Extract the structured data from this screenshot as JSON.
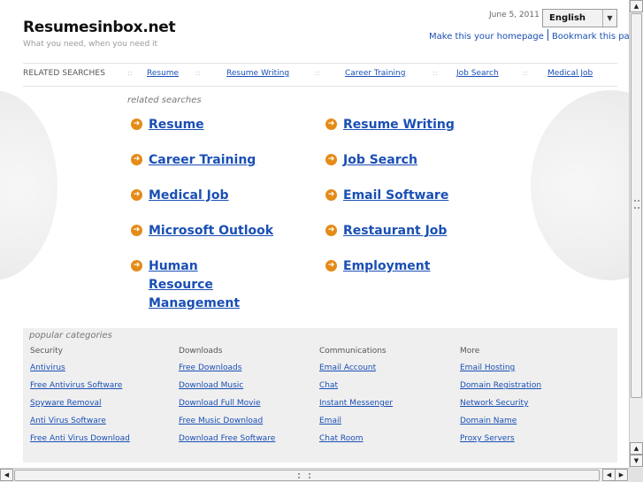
{
  "header": {
    "site_title": "Resumesinbox.net",
    "tagline": "What you need, when you need it",
    "date": "June 5, 2011",
    "language": "English",
    "links": [
      "Make this your homepage",
      "Bookmark this page"
    ]
  },
  "related_bar": {
    "label": "RELATED SEARCHES",
    "separator": "::",
    "links": [
      "Resume",
      "Resume Writing",
      "Career Training",
      "Job Search",
      "Medical Job"
    ]
  },
  "related_searches": {
    "heading": "related searches",
    "items": [
      "Resume",
      "Resume Writing",
      "Career Training",
      "Job Search",
      "Medical Job",
      "Email Software",
      "Microsoft Outlook",
      "Restaurant Job",
      "Human Resource Management",
      "Employment"
    ]
  },
  "popular": {
    "heading": "popular categories",
    "columns": [
      {
        "title": "Security",
        "links": [
          "Antivirus",
          "Free Antivirus Software",
          "Spyware Removal",
          "Anti Virus Software",
          "Free Anti Virus Download"
        ]
      },
      {
        "title": "Downloads",
        "links": [
          "Free Downloads",
          "Download Music",
          "Download Full Movie",
          "Free Music Download",
          "Download Free Software"
        ]
      },
      {
        "title": "Communications",
        "links": [
          "Email Account",
          "Chat",
          "Instant Messenger",
          "Email",
          "Chat Room"
        ]
      },
      {
        "title": "More",
        "links": [
          "Email Hosting",
          "Domain Registration",
          "Network Security",
          "Domain Name",
          "Proxy Servers"
        ]
      }
    ]
  },
  "icons": {
    "bullet": "orange-arrow-circle-icon",
    "dropdown": "chevron-down-icon"
  },
  "colors": {
    "link": "#1a4fb5",
    "bullet": "#e58b19",
    "panel": "#efefef"
  }
}
